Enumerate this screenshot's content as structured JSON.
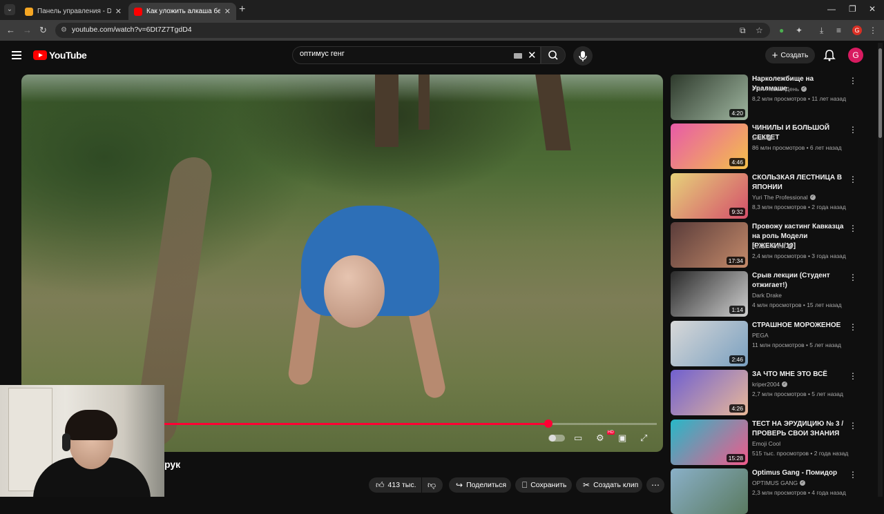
{
  "browser": {
    "tabs": [
      {
        "title": "Панель управления - Donatio",
        "active": false,
        "favicon_color": "#f5a623"
      },
      {
        "title": "Как уложить алкаша без слов",
        "active": true,
        "favicon_color": "#ff0000"
      }
    ],
    "url": "youtube.com/watch?v=6Dt7Z7TgdD4",
    "profile_initial": "G"
  },
  "header": {
    "logo_text": "YouTube",
    "search_value": "оптимус генг",
    "create_label": "Создать",
    "avatar_initial": "G"
  },
  "video": {
    "title_partial": "рук",
    "progress_fraction": 0.78,
    "actions": {
      "likes": "413 тыс.",
      "share": "Поделиться",
      "save": "Сохранить",
      "clip": "Создать клип"
    }
  },
  "recommendations": [
    {
      "title": "Нарколежбище на Уралмаше",
      "channel": "РИА Новый День",
      "verified": true,
      "meta": "8,2 млн просмотров • 11 лет назад",
      "duration": "4:20",
      "thumb_colors": [
        "#2e3a2c",
        "#9fb6a0"
      ]
    },
    {
      "title": "ЧИНИЛЫ И БОЛЬШОЙ СЕКРЕТ",
      "channel": "sndk",
      "verified": true,
      "meta": "86 млн просмотров • 6 лет назад",
      "duration": "4:46",
      "thumb_colors": [
        "#e85aa8",
        "#f4c04b"
      ]
    },
    {
      "title": "СКОЛЬЗКАЯ ЛЕСТНИЦА В ЯПОНИИ",
      "channel": "Yuri The Professional",
      "verified": true,
      "meta": "8,3 млн просмотров • 2 года назад",
      "duration": "9:32",
      "thumb_colors": [
        "#e6d27a",
        "#d44f6a"
      ]
    },
    {
      "title": "Провожу кастинг Кавказца на роль Модели [РЖЕКИЧ/10]",
      "channel": "Azazin Kreet",
      "verified": true,
      "meta": "2,4 млн просмотров • 3 года назад",
      "duration": "17:34",
      "thumb_colors": [
        "#5a3c3a",
        "#c48a6a"
      ]
    },
    {
      "title": "Срыв лекции (Студент отжигает!)",
      "channel": "Dark Drake",
      "verified": false,
      "meta": "4 млн просмотров • 15 лет назад",
      "duration": "1:14",
      "thumb_colors": [
        "#2a2a2a",
        "#cfcfcf"
      ]
    },
    {
      "title": "СТРАШНОЕ МОРОЖЕНОЕ",
      "channel": "PEGA",
      "verified": false,
      "meta": "11 млн просмотров • 5 лет назад",
      "duration": "2:46",
      "thumb_colors": [
        "#d8d8d8",
        "#7aa0c0"
      ]
    },
    {
      "title": "ЗА ЧТО МНЕ ЭТО ВСЁ",
      "channel": "kriper2004",
      "verified": true,
      "meta": "2,7 млн просмотров • 5 лет назад",
      "duration": "4:26",
      "thumb_colors": [
        "#7060d0",
        "#e8b898"
      ]
    },
    {
      "title": "ТЕСТ НА ЭРУДИЦИЮ № 3 / ПРОВЕРЬ СВОИ ЗНАНИЯ",
      "channel": "Emoji Cool",
      "verified": false,
      "meta": "515 тыс. просмотров • 2 года назад",
      "duration": "15:28",
      "thumb_colors": [
        "#27b8c8",
        "#f05a8a"
      ]
    },
    {
      "title": "Optimus Gang - Помидор",
      "channel": "OPTIMUS GANG",
      "verified": true,
      "meta": "2,3 млн просмотров • 4 года назад",
      "duration": "",
      "thumb_colors": [
        "#8ab0c8",
        "#5a7a60"
      ]
    }
  ]
}
